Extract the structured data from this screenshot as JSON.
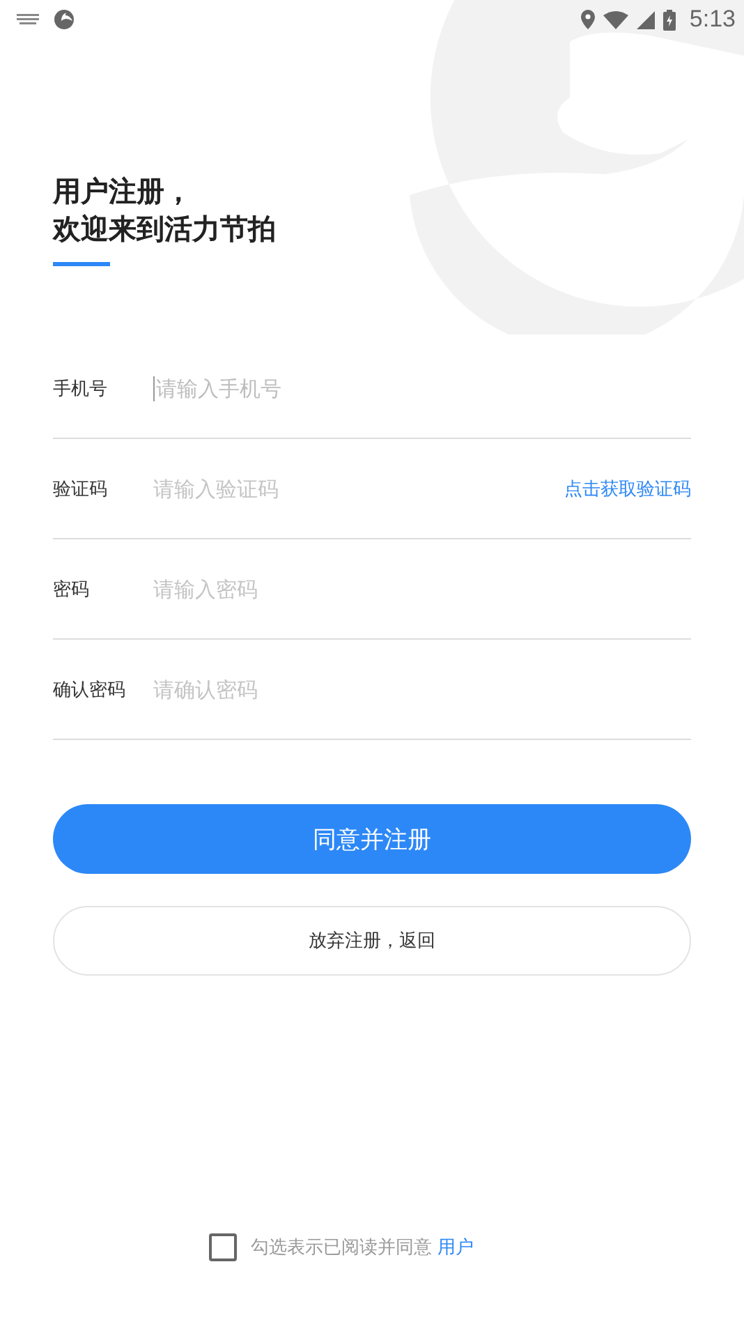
{
  "status_bar": {
    "time": "5:13"
  },
  "title": {
    "lines": [
      "用户注册，",
      "欢迎来到活力节拍"
    ]
  },
  "fields": [
    {
      "label": "手机号",
      "placeholder": "请输入手机号",
      "focused": true
    },
    {
      "label": "验证码",
      "placeholder": "请输入验证码",
      "focused": false,
      "action": "点击获取验证码"
    },
    {
      "label": "密码",
      "placeholder": "请输入密码",
      "focused": false
    },
    {
      "label": "确认密码",
      "placeholder": "请确认密码",
      "focused": false
    }
  ],
  "buttons": [
    {
      "label": "同意并注册",
      "kind": "primary"
    },
    {
      "label": "放弃注册，返回",
      "kind": "secondary"
    }
  ],
  "agreement": {
    "checked": false,
    "text": "勾选表示已阅读并同意",
    "link": "用户"
  }
}
